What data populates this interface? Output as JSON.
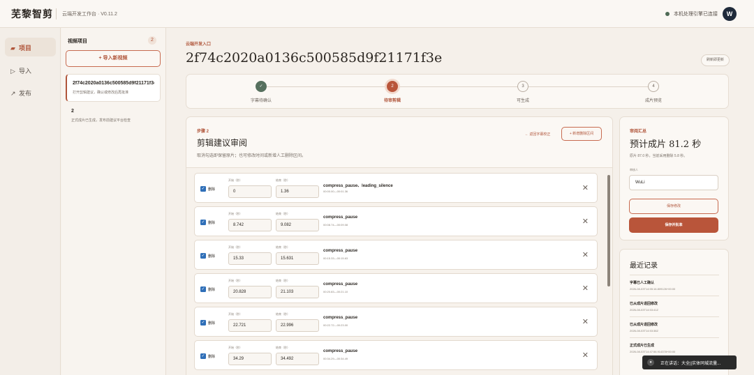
{
  "header": {
    "logo": "芜黎智剪",
    "subtitle": "云端开发工作台 · V0.11.2",
    "status": "本机处理引擎已连接",
    "avatar": "W"
  },
  "nav": {
    "items": [
      {
        "icon": "▰",
        "label": "项目",
        "active": true
      },
      {
        "icon": "▷",
        "label": "导入"
      },
      {
        "icon": "↗",
        "label": "发布"
      }
    ]
  },
  "videos": {
    "title": "视频项目",
    "count": "2",
    "import_label": "+ 导入新视频",
    "items": [
      {
        "title": "2f74c2020a0136c500585d9f21171f3e",
        "desc": "打开剪辑建议，确认或修改后再批准"
      },
      {
        "title": "2",
        "desc": "正式成片已生成，发布前建议平台检查"
      }
    ]
  },
  "main": {
    "entry_label": "云端开发入口",
    "title": "2f74c2020a0136c500585d9f21171f3e",
    "hint_button": "刷新即更新"
  },
  "stepper": {
    "steps": [
      {
        "num": "✓",
        "label": "字幕待确认",
        "state": "done"
      },
      {
        "num": "2",
        "label": "待审剪辑",
        "state": "current"
      },
      {
        "num": "3",
        "label": "可生成",
        "state": ""
      },
      {
        "num": "4",
        "label": "成片预览",
        "state": ""
      }
    ]
  },
  "editor": {
    "step_tag": "步骤 2",
    "title": "剪辑建议审阅",
    "desc": "取消勾选即保留原片；也可修改时间或新增人工删除区间。",
    "back_link": "← 返回字幕校正",
    "add_button": "+ 新增删除区间",
    "start_label": "开始（秒）",
    "end_label": "结束（秒）",
    "delete_label": "删除",
    "segments": [
      {
        "start": "0",
        "end": "1.36",
        "reason": "compress_pause、leading_silence",
        "time": "00:00.00—00:01.36"
      },
      {
        "start": "8.742",
        "end": "9.082",
        "reason": "compress_pause",
        "time": "00:08.74—00:09.08"
      },
      {
        "start": "15.33",
        "end": "15.631",
        "reason": "compress_pause",
        "time": "00:15.33—00:15.63"
      },
      {
        "start": "20.828",
        "end": "21.103",
        "reason": "compress_pause",
        "time": "00:20.83—00:21.10"
      },
      {
        "start": "22.721",
        "end": "22.996",
        "reason": "compress_pause",
        "time": "00:22.72—00:23.00"
      },
      {
        "start": "34.29",
        "end": "34.492",
        "reason": "compress_pause",
        "time": "00:34.29—00:34.49"
      }
    ]
  },
  "summary": {
    "tag": "审阅汇总",
    "big": "预计成片 81.2 秒",
    "note": "原片 87.0 秒，当前采用删除 5.8 秒。",
    "reviewer_label": "审核人",
    "reviewer_value": "WuLi",
    "save_label": "保存修改",
    "save_rollback_label": "保存并批准"
  },
  "records": {
    "title": "最近记录",
    "items": [
      {
        "title": "字幕已人工确认",
        "time": "2026-08-03T14:55:16.809126+00:00"
      },
      {
        "title": "已从成片退回修改",
        "time": "2026-08-03T14:53:41Z"
      },
      {
        "title": "已从成片退回修改",
        "time": "2026-08-03T14:53:38Z"
      },
      {
        "title": "正式成片已生成",
        "time": "2026-08-03T14:47:56.914378+00:00"
      }
    ]
  },
  "toast": {
    "text": "正在讲话：大全||实体同城流量..."
  }
}
